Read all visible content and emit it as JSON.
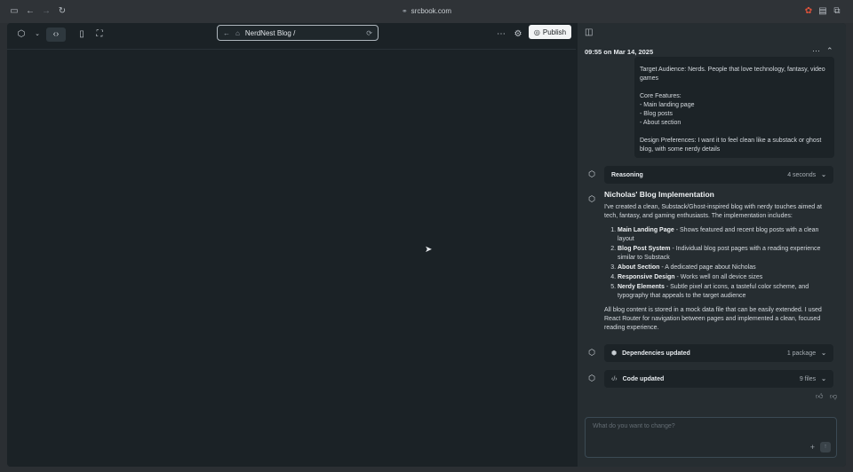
{
  "browser": {
    "url": "srcbook.com"
  },
  "toolbar": {
    "address": "NerdNest Blog /",
    "publish_label": "Publish"
  },
  "chat": {
    "timestamp": "09:55 on Mar 14, 2025",
    "user_message": "Target Audience: Nerds. People that love technology, fantasy, video games\n\nCore Features:\n- Main landing page\n- Blog posts\n- About section\n\nDesign Preferences: I want it to feel clean like a substack or ghost blog, with some nerdy details",
    "reasoning": {
      "label": "Reasoning",
      "meta": "4 seconds"
    },
    "reply": {
      "title": "Nicholas' Blog Implementation",
      "intro": "I've created a clean, Substack/Ghost-inspired blog with nerdy touches aimed at tech, fantasy, and gaming enthusiasts. The implementation includes:",
      "items": [
        {
          "bold": "Main Landing Page",
          "text": " - Shows featured and recent blog posts with a clean layout"
        },
        {
          "bold": "Blog Post System",
          "text": " - Individual blog post pages with a reading experience similar to Substack"
        },
        {
          "bold": "About Section",
          "text": " - A dedicated page about Nicholas"
        },
        {
          "bold": "Responsive Design",
          "text": " - Works well on all device sizes"
        },
        {
          "bold": "Nerdy Elements",
          "text": " - Subtle pixel art icons, a tasteful color scheme, and typography that appeals to the target audience"
        }
      ],
      "outro": "All blog content is stored in a mock data file that can be easily extended. I used React Router for navigation between pages and implemented a clean, focused reading experience."
    },
    "dependencies": {
      "label": "Dependencies updated",
      "meta": "1 package"
    },
    "code": {
      "label": "Code updated",
      "meta": "9 files"
    },
    "input_placeholder": "What do you want to change?"
  },
  "icons": {
    "sidebar": "sidebar-icon",
    "back": "arrow-left-icon",
    "forward": "arrow-right-icon",
    "reload": "reload-icon",
    "globe": "globe-icon"
  }
}
